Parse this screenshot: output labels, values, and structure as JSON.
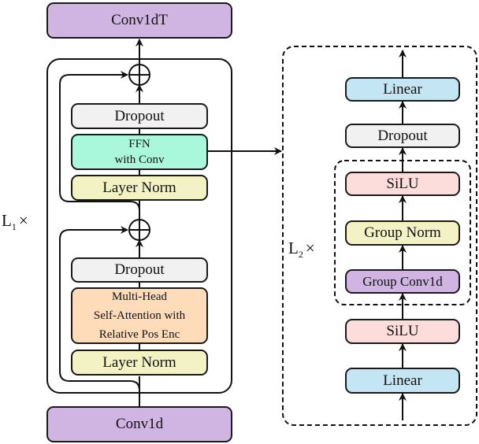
{
  "left_block": {
    "top": "Conv1dT",
    "bottom": "Conv1d",
    "repeat_label": "L",
    "repeat_sub": "1",
    "repeat_times": "×",
    "ffn_module": {
      "dropout": "Dropout",
      "ffn_line1": "FFN",
      "ffn_line2": "with Conv",
      "layer_norm": "Layer Norm"
    },
    "attention_module": {
      "dropout": "Dropout",
      "attn_line1": "Multi-Head",
      "attn_line2": "Self-Attention with",
      "attn_line3": "Relative Pos Enc",
      "layer_norm": "Layer Norm"
    },
    "residual_symbol": "+"
  },
  "right_block": {
    "linear_top": "Linear",
    "dropout": "Dropout",
    "inner": {
      "silu": "SiLU",
      "group_norm": "Group Norm",
      "group_conv": "Group Conv1d"
    },
    "silu": "SiLU",
    "linear_bottom": "Linear",
    "repeat_label": "L",
    "repeat_sub": "2",
    "repeat_times": "×"
  }
}
